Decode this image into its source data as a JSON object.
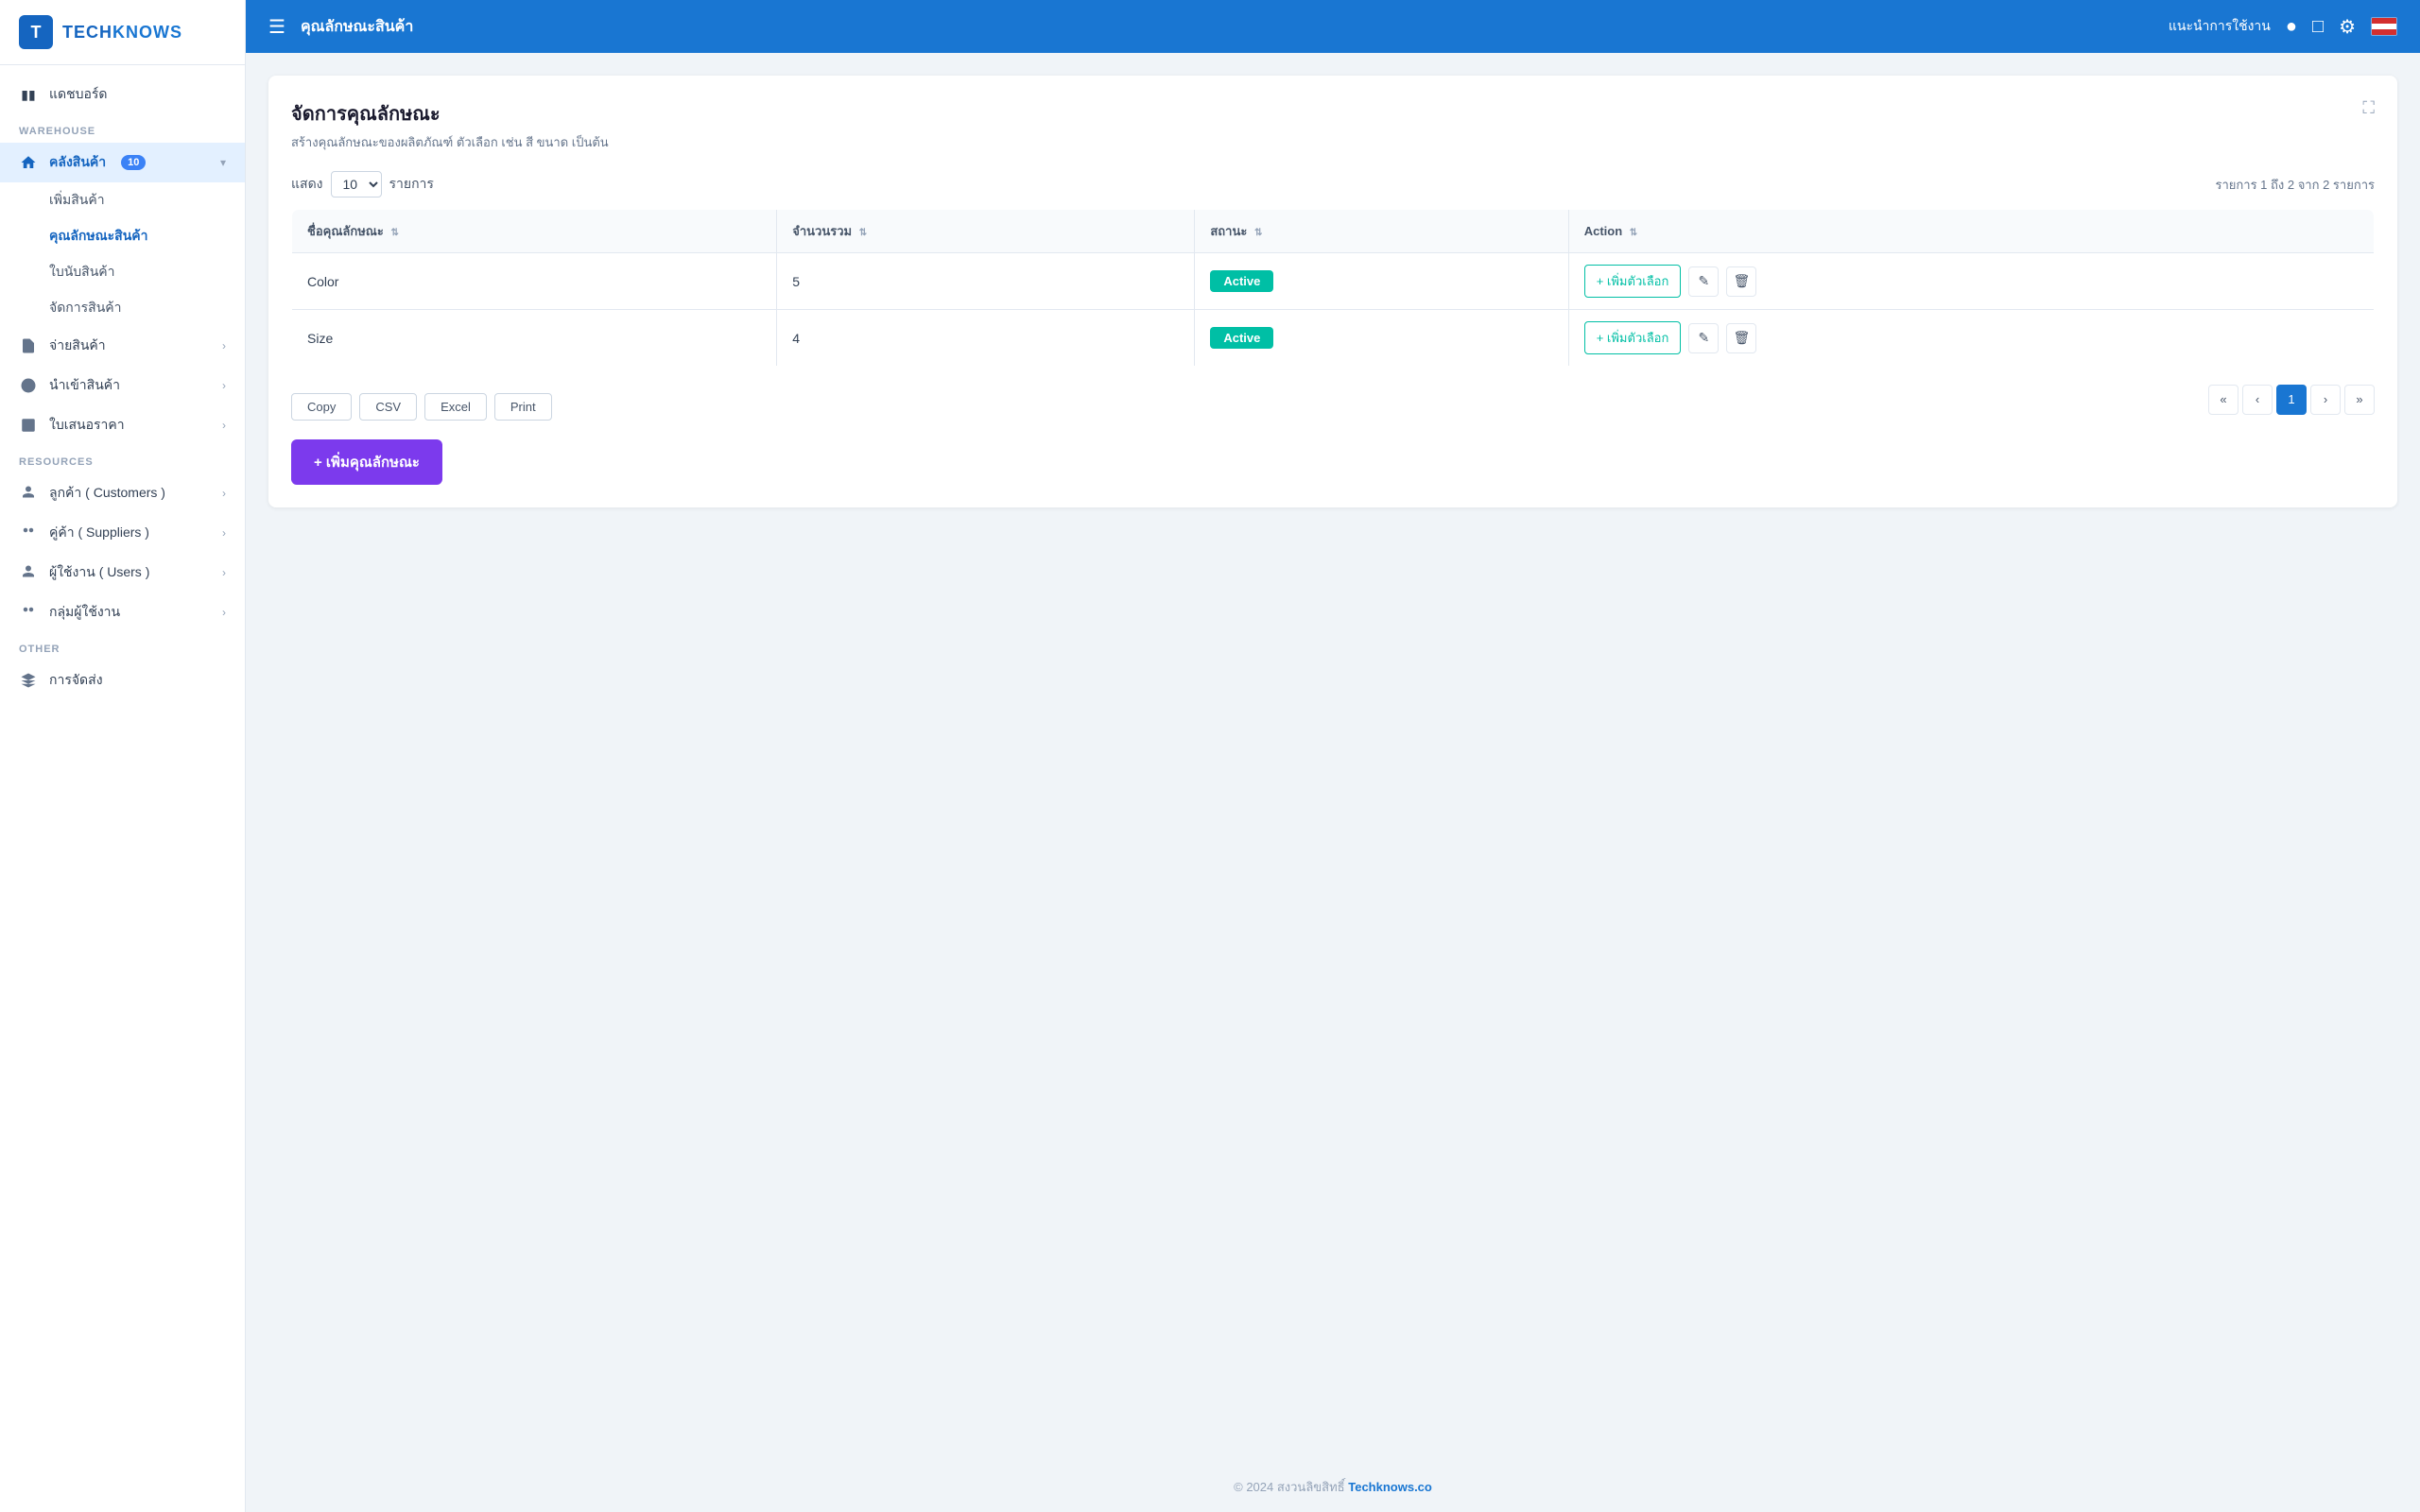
{
  "app": {
    "logo_letter": "T",
    "logo_name_1": "TECH",
    "logo_name_2": "KNOWS"
  },
  "sidebar": {
    "dashboard_label": "แดชบอร์ด",
    "warehouse_section": "WAREHOUSE",
    "warehouse_item": "คลังสินค้า",
    "warehouse_badge": "10",
    "warehouse_sub": [
      "เพิ่มสินค้า",
      "คุณลักษณะสินค้า",
      "ใบนับสินค้า",
      "จัดการสินค้า"
    ],
    "sell_label": "จ่ายสินค้า",
    "import_label": "นำเข้าสินค้า",
    "pricelist_label": "ใบเสนอราคา",
    "resources_section": "RESOURCES",
    "customers_label": "ลูกค้า ( Customers )",
    "suppliers_label": "คู่ค้า ( Suppliers )",
    "users_label": "ผู้ใช้งาน ( Users )",
    "groups_label": "กลุ่มผู้ใช้งาน",
    "other_section": "OTHER",
    "settings_label": "การจัดส่ง"
  },
  "topbar": {
    "title": "คุณลักษณะสินค้า",
    "help_label": "แนะนำการใช้งาน"
  },
  "page": {
    "title": "จัดการคุณลักษณะ",
    "subtitle": "สร้างคุณลักษณะของผลิตภัณฑ์ ตัวเลือก เช่น สี ขนาด เป็นต้น",
    "show_label": "แสดง",
    "per_page_label": "รายการ",
    "per_page_value": "10",
    "info_text": "รายการ 1 ถึง 2 จาก 2 รายการ",
    "col_name": "ชื่อคุณลักษณะ",
    "col_count": "จำนวนรวม",
    "col_status": "สถานะ",
    "col_action": "Action",
    "add_attribute_label": "+ เพิ่มคุณลักษณะ",
    "export_buttons": [
      "Copy",
      "CSV",
      "Excel",
      "Print"
    ],
    "rows": [
      {
        "name": "Color",
        "count": "5",
        "status": "Active"
      },
      {
        "name": "Size",
        "count": "4",
        "status": "Active"
      }
    ],
    "add_option_label": "+ เพิ่มตัวเลือก",
    "pagination": {
      "prev_prev": "«",
      "prev": "‹",
      "current": "1",
      "next": "›",
      "next_next": "»"
    }
  },
  "footer": {
    "copyright": "© 2024 สงวนลิขสิทธิ์",
    "brand": "Techknows.co"
  }
}
